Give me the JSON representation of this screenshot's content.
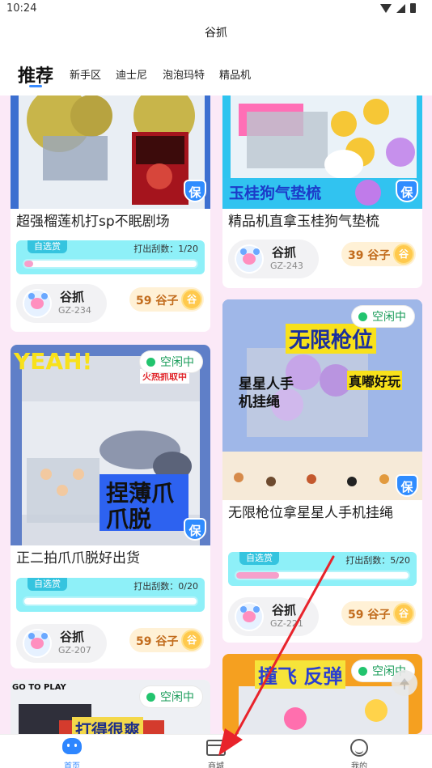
{
  "status_bar": {
    "time": "10:24"
  },
  "header": {
    "title": "谷抓"
  },
  "tabs": [
    {
      "label": "推荐",
      "active": true
    },
    {
      "label": "新手区"
    },
    {
      "label": "迪士尼"
    },
    {
      "label": "泡泡玛特"
    },
    {
      "label": "精品机"
    }
  ],
  "labels": {
    "free_tag": "自选赏",
    "progress_prefix": "打出刮数：",
    "idle": "空闲中",
    "bao": "保",
    "coin": "谷"
  },
  "cards": [
    {
      "title": "超强榴莲机打sp不眠剧场",
      "machine_name": "谷抓",
      "machine_code": "GZ-234",
      "price": "59 谷子",
      "progress_text": "1/20",
      "progress_fraction": 0.05
    },
    {
      "title": "精品机直拿玉桂狗气垫梳",
      "banner": "玉桂狗气垫梳",
      "machine_name": "谷抓",
      "machine_code": "GZ-243",
      "price": "39 谷子"
    },
    {
      "title": "正二拍爪爪脱好出货",
      "banner_top": "YEAH!",
      "banner_tag": "火热抓取中",
      "banner_main": "捏薄爪爪脱",
      "machine_name": "谷抓",
      "machine_code": "GZ-207",
      "price": "59 谷子",
      "progress_text": "0/20",
      "progress_fraction": 0
    },
    {
      "title": "无限枪位拿星星人手机挂绳",
      "banner_main": "无限枪位",
      "banner_left": "星星人手机挂绳",
      "banner_right": "真嘟好玩",
      "machine_name": "谷抓",
      "machine_code": "GZ-221",
      "price": "59 谷子",
      "progress_text": "5/20",
      "progress_fraction": 0.25
    },
    {
      "banner_top": "GO TO PLAY",
      "banner_main": "打得很爽"
    },
    {
      "banner_main": "撞飞 反弹"
    }
  ],
  "bottom_nav": [
    {
      "label": "首页",
      "icon": "home-icon",
      "active": true
    },
    {
      "label": "商城",
      "icon": "shop-icon"
    },
    {
      "label": "我的",
      "icon": "smile-icon"
    }
  ],
  "colors": {
    "accent": "#2e86ff",
    "idle_green": "#22c46e",
    "progress_fill": "#f6a0cb",
    "progress_box": "#8ef0f8",
    "feed_bg": "#fbe9f7",
    "annotation_arrow": "#e8232b"
  }
}
